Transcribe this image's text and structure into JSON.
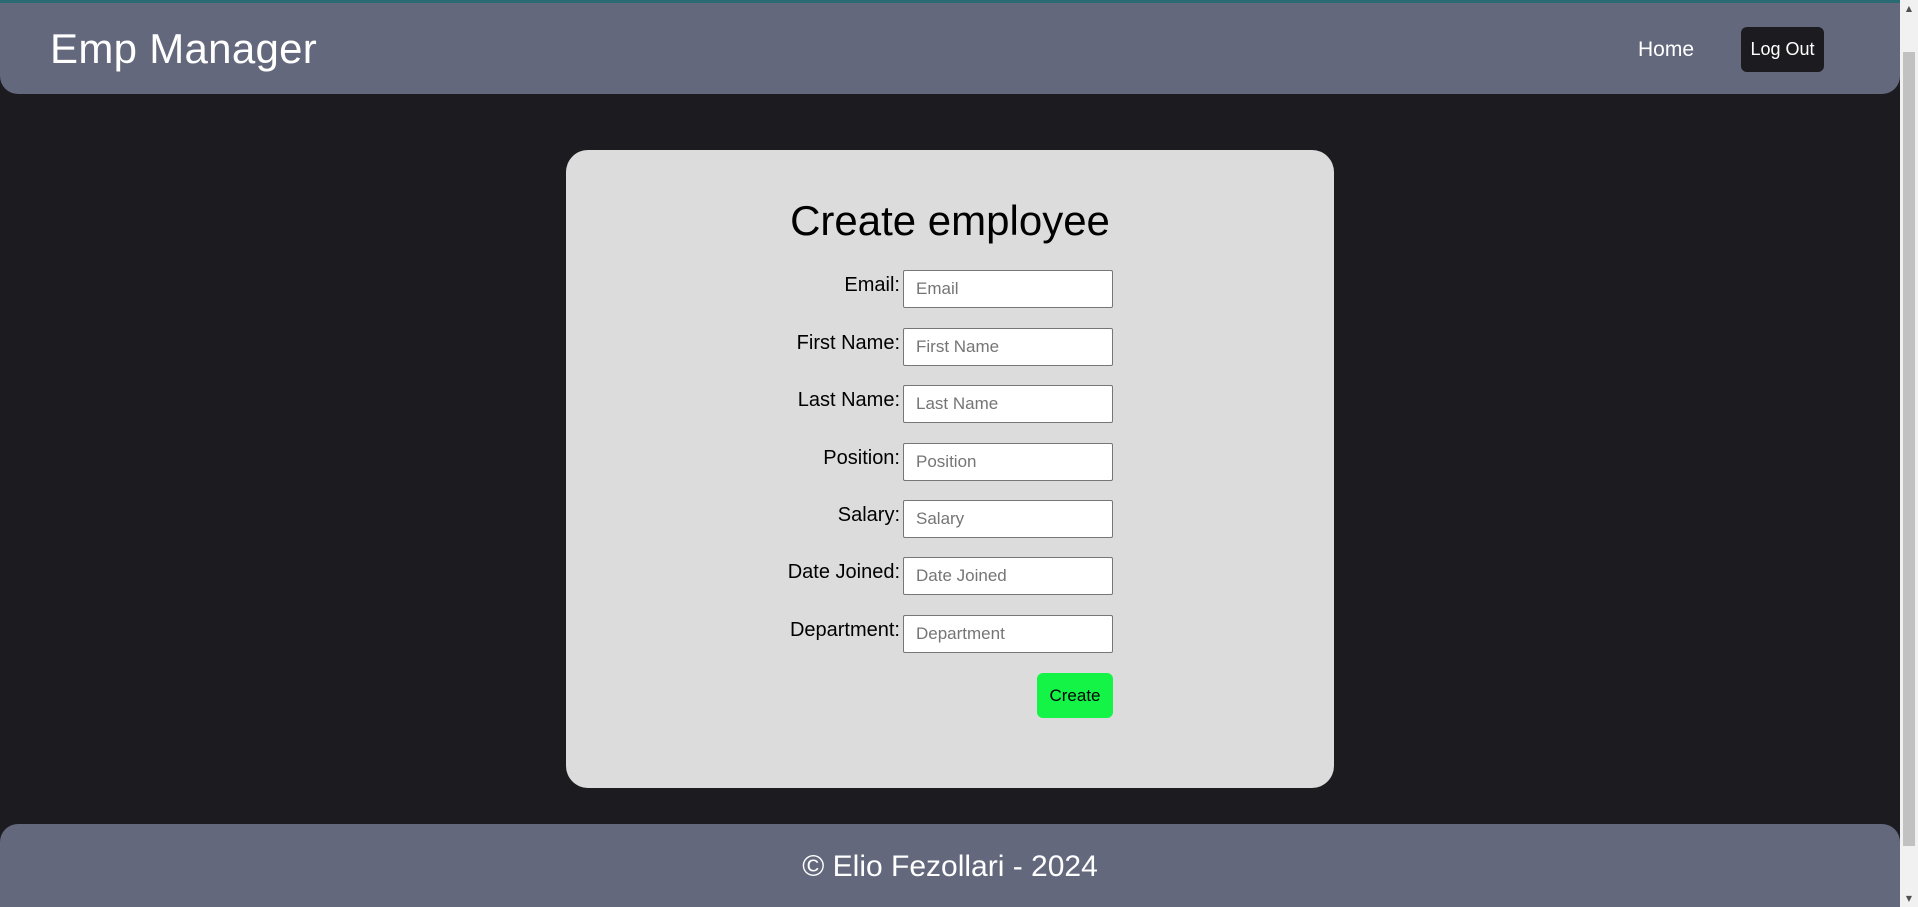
{
  "header": {
    "brand": "Emp Manager",
    "nav_home": "Home",
    "nav_logout": "Log Out"
  },
  "form": {
    "title": "Create employee",
    "fields": [
      {
        "label": "Email:",
        "placeholder": "Email"
      },
      {
        "label": "First Name:",
        "placeholder": "First Name"
      },
      {
        "label": "Last Name:",
        "placeholder": "Last Name"
      },
      {
        "label": "Position:",
        "placeholder": "Position"
      },
      {
        "label": "Salary:",
        "placeholder": "Salary"
      },
      {
        "label": "Date Joined:",
        "placeholder": "Date Joined"
      },
      {
        "label": "Department:",
        "placeholder": "Department"
      }
    ],
    "submit_label": "Create"
  },
  "footer": {
    "copyright": "© Elio Fezollari - 2024"
  },
  "colors": {
    "background": "#1c1b20",
    "bar": "#63687d",
    "card": "#dcdcdc",
    "create_button": "#14f447"
  },
  "scrollbar": {
    "arrow_up_icon": "▲",
    "arrow_down_icon": "▼"
  }
}
